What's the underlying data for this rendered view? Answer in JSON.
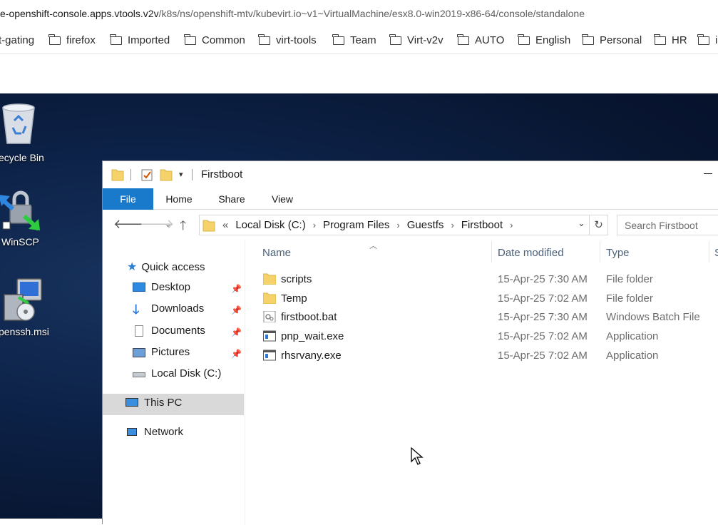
{
  "browser": {
    "url_host": "e-openshift-console.apps.vtools.v2v",
    "url_path": "/k8s/ns/openshift-mtv/kubevirt.io~v1~VirtualMachine/esx8.0-win2019-x86-64/console/standalone",
    "bookmarks": [
      "t-gating",
      "firefox",
      "Imported",
      "Common",
      "virt-tools",
      "Team",
      "Virt-v2v",
      "AUTO",
      "English",
      "Personal",
      "HR",
      "i"
    ]
  },
  "desktop": {
    "icons": [
      {
        "label": "ecycle Bin",
        "icon": "recycle-bin-icon"
      },
      {
        "label": "WinSCP",
        "icon": "winscp-icon"
      },
      {
        "label": "penssh.msi",
        "icon": "msi-installer-icon"
      }
    ]
  },
  "explorer": {
    "title": "Firstboot",
    "ribbon_tabs": [
      "File",
      "Home",
      "Share",
      "View"
    ],
    "address": {
      "prefix": "«",
      "crumbs": [
        "Local Disk (C:)",
        "Program Files",
        "Guestfs",
        "Firstboot"
      ]
    },
    "search_placeholder": "Search Firstboot",
    "nav": {
      "quick_access": "Quick access",
      "items": [
        "Desktop",
        "Downloads",
        "Documents",
        "Pictures",
        "Local Disk (C:)"
      ],
      "this_pc": "This PC",
      "network": "Network"
    },
    "columns": {
      "name": "Name",
      "date": "Date modified",
      "type": "Type",
      "size": "S"
    },
    "files": [
      {
        "name": "scripts",
        "date": "15-Apr-25 7:30 AM",
        "type": "File folder",
        "icon": "folder-icon"
      },
      {
        "name": "Temp",
        "date": "15-Apr-25 7:02 AM",
        "type": "File folder",
        "icon": "folder-icon"
      },
      {
        "name": "firstboot.bat",
        "date": "15-Apr-25 7:30 AM",
        "type": "Windows Batch File",
        "icon": "batch-file-icon"
      },
      {
        "name": "pnp_wait.exe",
        "date": "15-Apr-25 7:02 AM",
        "type": "Application",
        "icon": "exe-icon"
      },
      {
        "name": "rhsrvany.exe",
        "date": "15-Apr-25 7:02 AM",
        "type": "Application",
        "icon": "exe-icon"
      }
    ]
  },
  "colors": {
    "accent": "#1979ca",
    "folder": "#f5d36a",
    "selected": "#d9d9d9",
    "desktop": "#0d2248"
  }
}
